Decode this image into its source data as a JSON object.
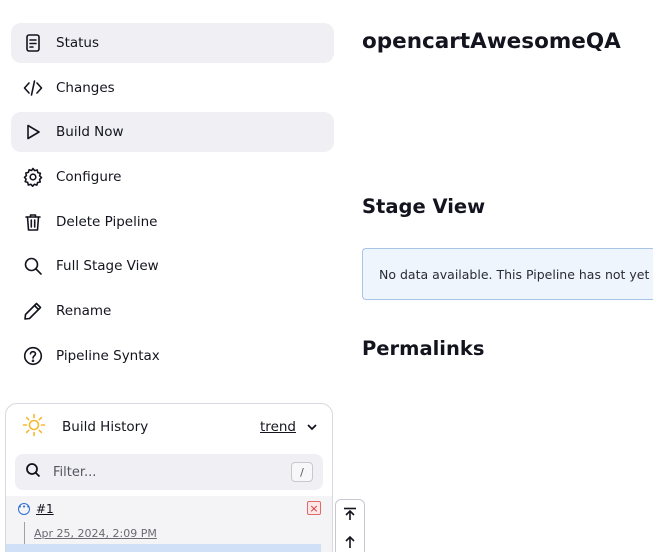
{
  "sidebar": {
    "items": [
      {
        "label": "Status",
        "icon": "status-icon",
        "active": true
      },
      {
        "label": "Changes",
        "icon": "code-icon",
        "active": false
      },
      {
        "label": "Build Now",
        "icon": "play-icon",
        "active": true
      },
      {
        "label": "Configure",
        "icon": "gear-icon",
        "active": false
      },
      {
        "label": "Delete Pipeline",
        "icon": "trash-icon",
        "active": false
      },
      {
        "label": "Full Stage View",
        "icon": "search-icon",
        "active": false
      },
      {
        "label": "Rename",
        "icon": "pencil-icon",
        "active": false
      },
      {
        "label": "Pipeline Syntax",
        "icon": "help-icon",
        "active": false
      }
    ]
  },
  "history": {
    "title": "Build History",
    "trend_label": "trend",
    "filter_placeholder": "Filter...",
    "filter_shortcut": "/",
    "builds": [
      {
        "number": "#1",
        "date": "Apr 25, 2024, 2:09 PM",
        "status": "running",
        "delete_symbol": "×"
      }
    ]
  },
  "main": {
    "title": "opencartAwesomeQA",
    "stage_view_title": "Stage View",
    "stage_view_message": "No data available. This Pipeline has not yet run.",
    "permalinks_title": "Permalinks"
  },
  "colors": {
    "active_bg": "#efeff4",
    "info_bg": "#eef5fd",
    "info_border": "#a9c4e4",
    "sun": "#f5b82e",
    "running": "#2c6ed4",
    "delete": "#e06a6a"
  }
}
